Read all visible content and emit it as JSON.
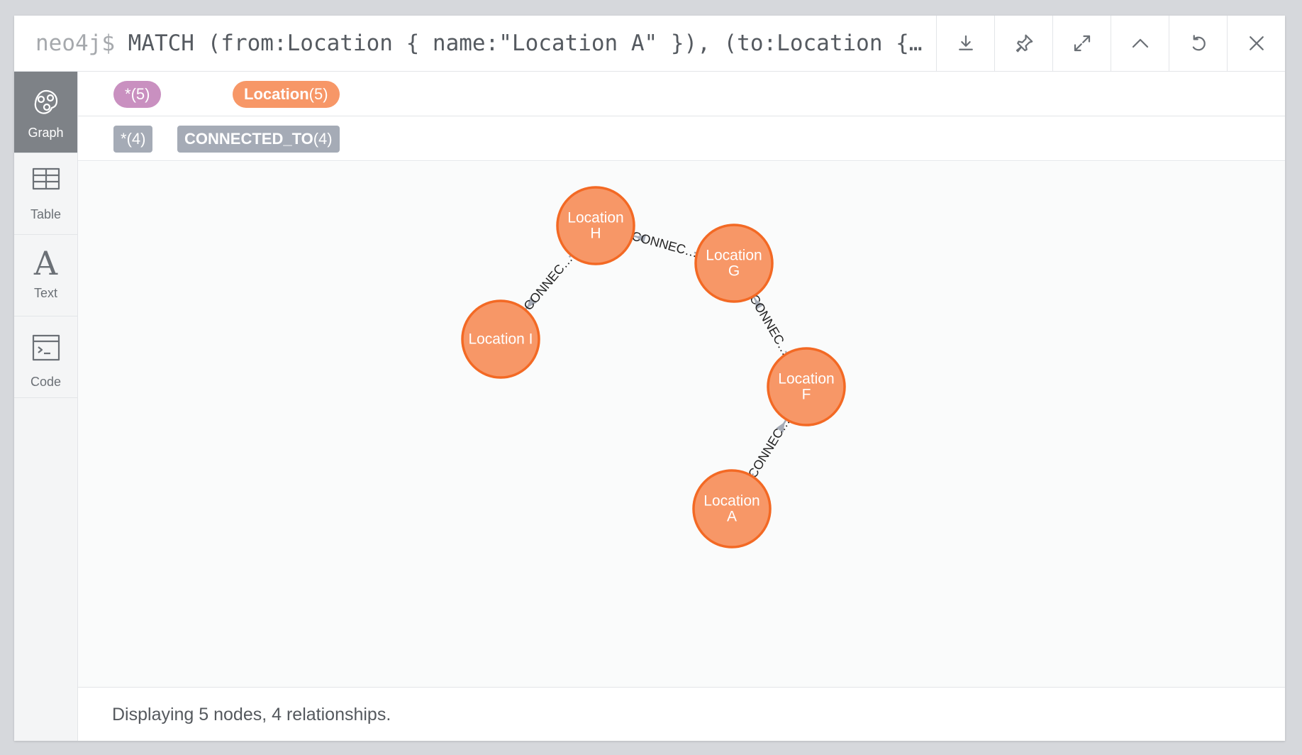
{
  "header": {
    "prompt": "neo4j$",
    "query": "MATCH (from:Location { name:\"Location A\" }), (to:Location {…",
    "buttons": [
      "download-icon",
      "pin-icon",
      "expand-icon",
      "collapse-icon",
      "rerun-icon",
      "close-icon"
    ]
  },
  "sidebar": {
    "items": [
      {
        "label": "Graph",
        "icon": "graph-icon",
        "active": true
      },
      {
        "label": "Table",
        "icon": "table-icon",
        "active": false
      },
      {
        "label": "Text",
        "icon": "text-icon",
        "active": false
      },
      {
        "label": "Code",
        "icon": "code-icon",
        "active": false
      }
    ]
  },
  "legend": {
    "all_nodes": {
      "name": "*",
      "count": "(5)",
      "color": "#c990c0"
    },
    "location": {
      "name": "Location",
      "count": "(5)",
      "color": "#f79767"
    },
    "all_rels": {
      "name": "*",
      "count": "(4)",
      "color": "#a5abb6"
    },
    "connected_to": {
      "name": "CONNECTED_TO",
      "count": "(4)",
      "color": "#a5abb6"
    }
  },
  "graph": {
    "node_fill": "#f79767",
    "node_stroke": "#f36924",
    "edge_color": "#a5abb6",
    "nodes": [
      {
        "id": "H",
        "lines": [
          "Location",
          "H"
        ]
      },
      {
        "id": "G",
        "lines": [
          "Location",
          "G"
        ]
      },
      {
        "id": "I",
        "lines": [
          "Location I"
        ]
      },
      {
        "id": "F",
        "lines": [
          "Location",
          "F"
        ]
      },
      {
        "id": "A",
        "lines": [
          "Location",
          "A"
        ]
      }
    ],
    "edges": [
      {
        "from": "G",
        "to": "H",
        "label": "CONNEC…"
      },
      {
        "from": "H",
        "to": "I",
        "label": "CONNEC…"
      },
      {
        "from": "F",
        "to": "G",
        "label": "CONNEC…"
      },
      {
        "from": "A",
        "to": "F",
        "label": "CONNEC…"
      }
    ]
  },
  "footer": {
    "status": "Displaying 5 nodes, 4 relationships."
  }
}
